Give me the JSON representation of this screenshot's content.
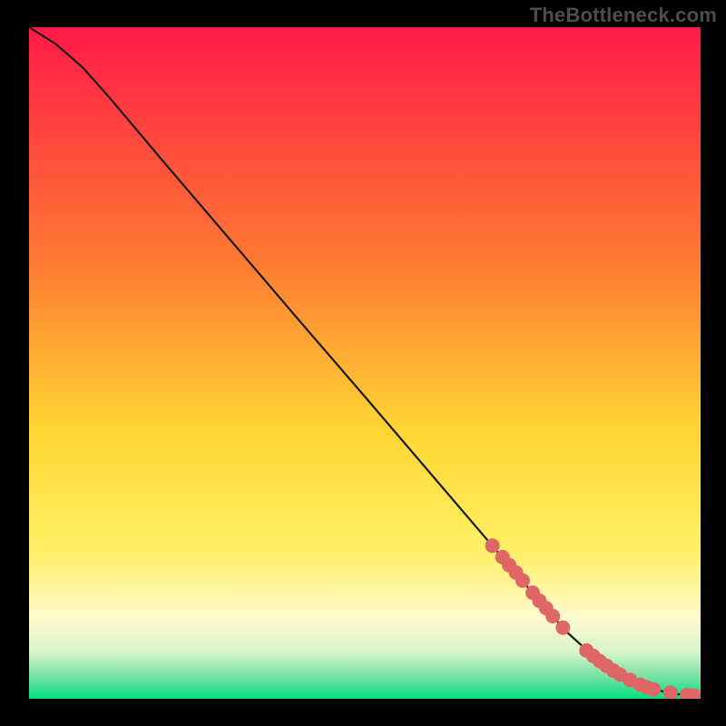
{
  "watermark": "TheBottleneck.com",
  "chart_data": {
    "type": "line",
    "title": "",
    "xlabel": "",
    "ylabel": "",
    "xlim": [
      0,
      100
    ],
    "ylim": [
      0,
      100
    ],
    "curve": {
      "x": [
        0,
        4,
        8,
        12,
        20,
        30,
        40,
        50,
        60,
        70,
        76,
        80,
        84,
        88,
        92,
        96,
        100
      ],
      "y": [
        100,
        97.5,
        94,
        89.5,
        80,
        68.3,
        56.6,
        45,
        33.3,
        21.6,
        14.6,
        10,
        6.4,
        3.6,
        1.7,
        0.7,
        0.5
      ]
    },
    "markers": {
      "x": [
        69,
        70.5,
        71.5,
        72.5,
        73.5,
        75,
        76,
        77,
        78,
        79.5,
        83,
        84,
        85,
        86,
        87,
        88,
        89.5,
        91,
        92,
        93,
        95.5,
        98,
        99
      ],
      "y": [
        22.8,
        21.1,
        19.9,
        18.8,
        17.6,
        15.8,
        14.6,
        13.5,
        12.3,
        10.6,
        7.2,
        6.4,
        5.6,
        4.9,
        4.2,
        3.6,
        2.8,
        2.1,
        1.7,
        1.4,
        0.9,
        0.6,
        0.5
      ],
      "color": "#e06666",
      "radius_px": 8
    },
    "gradient_stops": [
      {
        "offset": 0.0,
        "color": "#ff1a47"
      },
      {
        "offset": 0.35,
        "color": "#ff7a33"
      },
      {
        "offset": 0.6,
        "color": "#ffd633"
      },
      {
        "offset": 0.78,
        "color": "#fff066"
      },
      {
        "offset": 0.88,
        "color": "#fffacd"
      },
      {
        "offset": 0.93,
        "color": "#d7f5c9"
      },
      {
        "offset": 0.965,
        "color": "#7de3a6"
      },
      {
        "offset": 1.0,
        "color": "#00e080"
      }
    ],
    "line_color": "#1a1a1a"
  }
}
